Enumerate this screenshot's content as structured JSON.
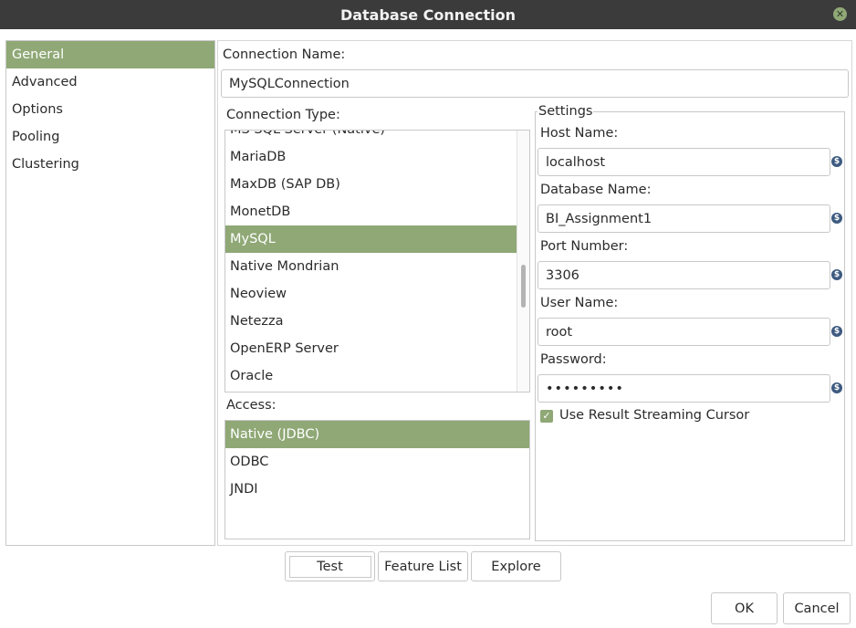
{
  "window": {
    "title": "Database Connection",
    "close_icon": "close-icon"
  },
  "nav": {
    "items": [
      {
        "label": "General",
        "selected": true
      },
      {
        "label": "Advanced",
        "selected": false
      },
      {
        "label": "Options",
        "selected": false
      },
      {
        "label": "Pooling",
        "selected": false
      },
      {
        "label": "Clustering",
        "selected": false
      }
    ]
  },
  "general": {
    "connection_name_label": "Connection Name:",
    "connection_name_value": "MySQLConnection",
    "connection_type_label": "Connection Type:",
    "connection_types": [
      "MS SQL Server (Native)",
      "MariaDB",
      "MaxDB (SAP DB)",
      "MonetDB",
      "MySQL",
      "Native Mondrian",
      "Neoview",
      "Netezza",
      "OpenERP Server",
      "Oracle"
    ],
    "selected_connection_type": "MySQL",
    "access_label": "Access:",
    "access_options": [
      "Native (JDBC)",
      "ODBC",
      "JNDI"
    ],
    "selected_access": "Native (JDBC)"
  },
  "settings": {
    "title": "Settings",
    "host_name_label": "Host Name:",
    "host_name_value": "localhost",
    "database_name_label": "Database Name:",
    "database_name_value": "BI_Assignment1",
    "port_number_label": "Port Number:",
    "port_number_value": "3306",
    "user_name_label": "User Name:",
    "user_name_value": "root",
    "password_label": "Password:",
    "password_value": "•••••••••",
    "streaming_cursor_label": "Use Result Streaming Cursor",
    "streaming_cursor_checked": true
  },
  "buttons": {
    "test": "Test",
    "feature_list": "Feature List",
    "explore": "Explore",
    "ok": "OK",
    "cancel": "Cancel"
  },
  "colors": {
    "accent": "#8fa876",
    "titlebar": "#3b3b3b"
  }
}
